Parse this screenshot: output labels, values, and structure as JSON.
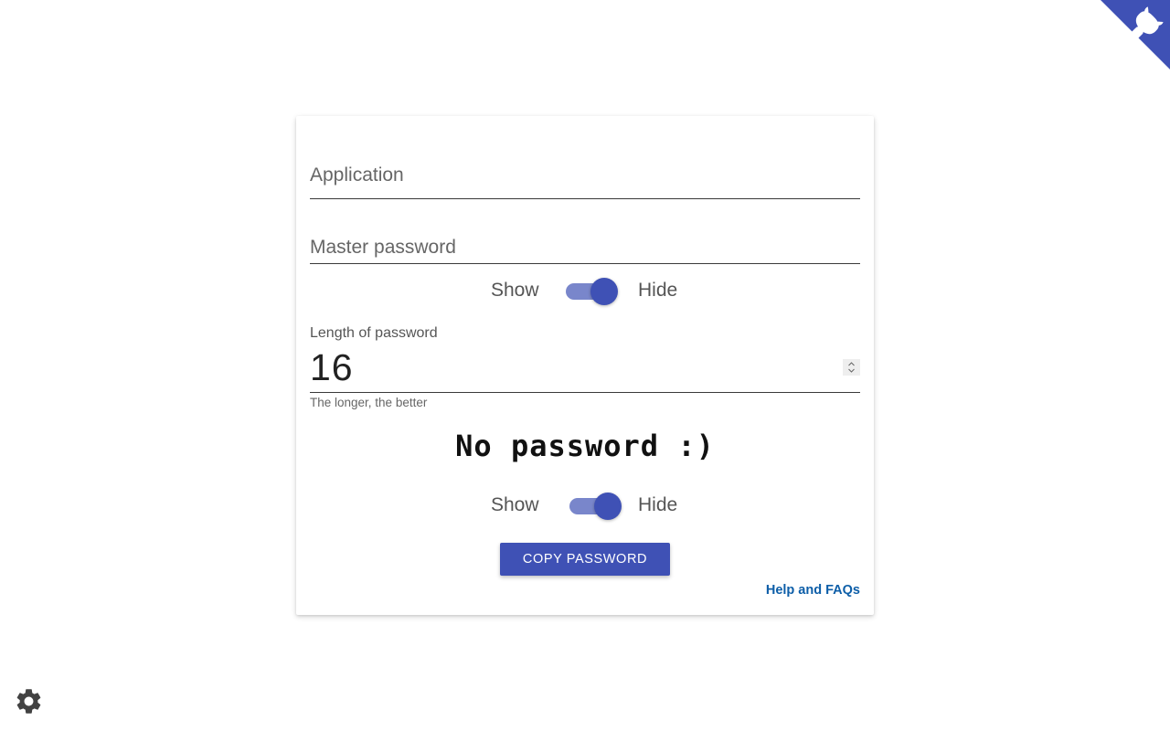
{
  "form": {
    "application_placeholder": "Application",
    "application_value": "",
    "master_placeholder": "Master password",
    "master_value": "",
    "master_toggle": {
      "show_label": "Show",
      "hide_label": "Hide",
      "state": "hide"
    },
    "length_label": "Length of password",
    "length_value": "16",
    "length_hint": "The longer, the better",
    "output_password": "No password :)",
    "output_toggle": {
      "show_label": "Show",
      "hide_label": "Hide",
      "state": "hide"
    },
    "copy_label": "COPY PASSWORD",
    "help_label": "Help and FAQs"
  },
  "icons": {
    "corner": "github-corner-icon",
    "settings": "gear-icon",
    "stepper": "number-stepper-icon"
  },
  "colors": {
    "primary": "#3f51b5",
    "primary_light": "#7986cb",
    "link": "#0d5ea8",
    "gear": "#424242"
  }
}
